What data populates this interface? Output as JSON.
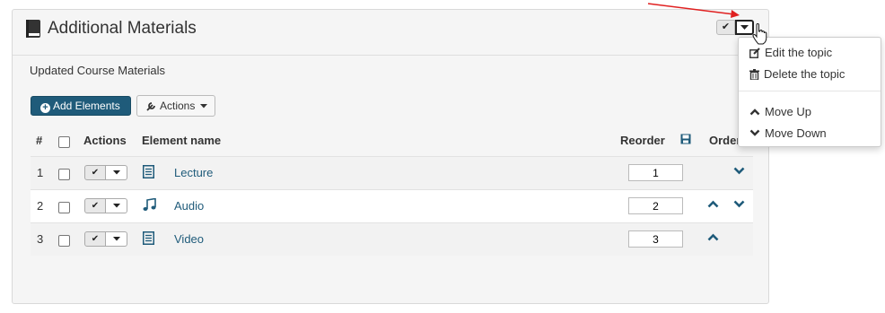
{
  "panel": {
    "title": "Additional Materials",
    "subtitle": "Updated Course Materials"
  },
  "toolbar": {
    "add_label": "Add Elements",
    "actions_label": "Actions"
  },
  "table": {
    "headers": {
      "num": "#",
      "actions": "Actions",
      "element_name": "Element name",
      "reorder": "Reorder",
      "order": "Order"
    },
    "rows": [
      {
        "num": "1",
        "name": "Lecture",
        "icon": "document-icon",
        "order": "1",
        "up": false,
        "down": true
      },
      {
        "num": "2",
        "name": "Audio",
        "icon": "music-icon",
        "order": "2",
        "up": true,
        "down": true
      },
      {
        "num": "3",
        "name": "Video",
        "icon": "document-icon",
        "order": "3",
        "up": true,
        "down": false
      }
    ]
  },
  "dropdown": {
    "items": [
      {
        "label": "Edit the topic",
        "icon": "edit-icon"
      },
      {
        "label": "Delete the topic",
        "icon": "trash-icon"
      },
      {
        "label": "Move Up",
        "icon": "chevron-up-icon"
      },
      {
        "label": "Move Down",
        "icon": "chevron-down-icon"
      }
    ]
  },
  "colors": {
    "accent": "#1f5b7a",
    "annotation_arrow": "#e02020"
  }
}
